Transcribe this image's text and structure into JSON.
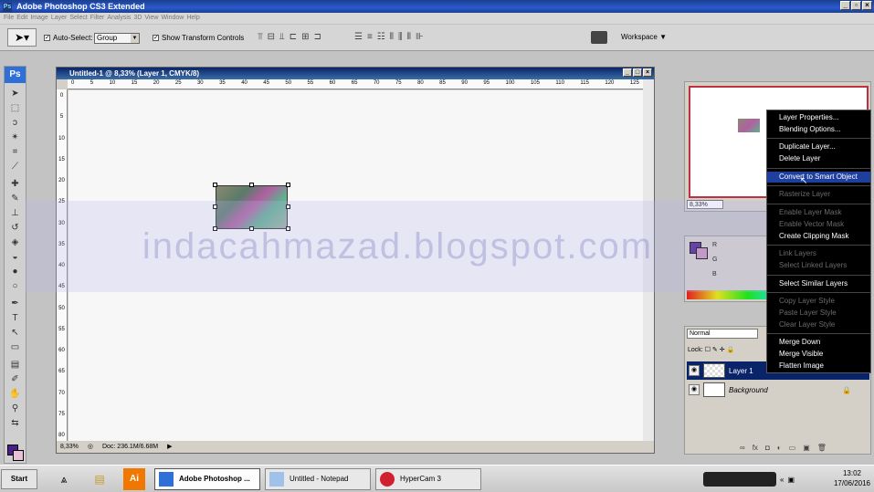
{
  "window": {
    "title": "Adobe Photoshop CS3 Extended",
    "app_icon": "ps-icon"
  },
  "menubar": {
    "items": [
      "File",
      "Edit",
      "Image",
      "Layer",
      "Select",
      "Filter",
      "Analysis",
      "3D",
      "View",
      "Window",
      "Help"
    ]
  },
  "options": {
    "auto_select_label": "Auto-Select:",
    "auto_select_checked": true,
    "auto_select_value": "Group",
    "show_transform_label": "Show Transform Controls",
    "show_transform_checked": true,
    "workspace_label": "Workspace ▼"
  },
  "document": {
    "title": "Untitled-1 @ 8,33% (Layer 1, CMYK/8)",
    "ruler_top": [
      "0",
      "5",
      "10",
      "15",
      "20",
      "25",
      "30",
      "35",
      "40",
      "45",
      "50",
      "55",
      "60",
      "65",
      "70",
      "75",
      "80",
      "85",
      "90",
      "95",
      "100",
      "105",
      "110",
      "115",
      "120",
      "125"
    ],
    "ruler_left": [
      "0",
      "5",
      "10",
      "15",
      "20",
      "25",
      "30",
      "35",
      "40",
      "45",
      "50",
      "55",
      "60",
      "65",
      "70",
      "75",
      "80"
    ],
    "zoom": "8,33%",
    "doc_size": "Doc: 236.1M/6.68M"
  },
  "watermark": "indacahmazad.blogspot.com",
  "navigator": {
    "zoom": "8,33%"
  },
  "color": {
    "fg": "#4b1f8a",
    "bg": "#c890b8",
    "labels": [
      "R",
      "G",
      "B"
    ]
  },
  "layers": {
    "blend_mode": "Normal",
    "lock_label": "Lock:",
    "rows": [
      {
        "name": "Layer 1",
        "active": true
      },
      {
        "name": "Background",
        "active": false,
        "locked": true
      }
    ]
  },
  "context_menu": {
    "groups": [
      [
        {
          "label": "Layer Properties...",
          "enabled": true
        },
        {
          "label": "Blending Options...",
          "enabled": true
        }
      ],
      [
        {
          "label": "Duplicate Layer...",
          "enabled": true
        },
        {
          "label": "Delete Layer",
          "enabled": true
        }
      ],
      [
        {
          "label": "Convert to Smart Object",
          "enabled": true,
          "highlighted": true
        }
      ],
      [
        {
          "label": "Rasterize Layer",
          "enabled": false
        }
      ],
      [
        {
          "label": "Enable Layer Mask",
          "enabled": false
        },
        {
          "label": "Enable Vector Mask",
          "enabled": false
        },
        {
          "label": "Create Clipping Mask",
          "enabled": true
        }
      ],
      [
        {
          "label": "Link Layers",
          "enabled": false
        },
        {
          "label": "Select Linked Layers",
          "enabled": false
        }
      ],
      [
        {
          "label": "Select Similar Layers",
          "enabled": true
        }
      ],
      [
        {
          "label": "Copy Layer Style",
          "enabled": false
        },
        {
          "label": "Paste Layer Style",
          "enabled": false
        },
        {
          "label": "Clear Layer Style",
          "enabled": false
        }
      ],
      [
        {
          "label": "Merge Down",
          "enabled": true
        },
        {
          "label": "Merge Visible",
          "enabled": true
        },
        {
          "label": "Flatten Image",
          "enabled": true
        }
      ]
    ]
  },
  "taskbar": {
    "start": "Start",
    "tasks": [
      {
        "label": "Adobe Photoshop ...",
        "active": true,
        "icon": "photoshop-icon"
      },
      {
        "label": "Untitled - Notepad",
        "active": false,
        "icon": "notepad-icon"
      },
      {
        "label": "HyperCam 3",
        "active": false,
        "icon": "hypercam-icon"
      }
    ],
    "time": "13:02",
    "date": "17/06/2016"
  }
}
